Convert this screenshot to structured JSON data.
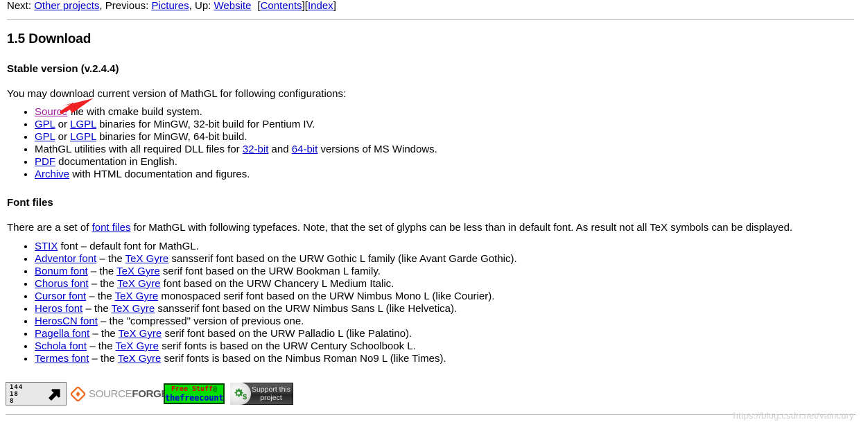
{
  "nav": {
    "next_label": "Next:",
    "next_link": "Other projects",
    "comma1": ",",
    "prev_label": "Previous:",
    "prev_link": "Pictures",
    "comma2": ",",
    "up_label": "Up:",
    "up_link": "Website",
    "bracket_open": "[",
    "contents_link": "Contents",
    "bracket_mid": "][",
    "index_link": "Index",
    "bracket_close": "]"
  },
  "section": {
    "heading": "1.5 Download",
    "subheading": "Stable version (v.2.4.4)",
    "intro": "You may download current version of MathGL for following configurations:"
  },
  "download_items": [
    {
      "parts": [
        {
          "text": "Source",
          "type": "link",
          "state": "visited"
        },
        {
          "text": " file with cmake build system.",
          "type": "text"
        }
      ]
    },
    {
      "parts": [
        {
          "text": "GPL",
          "type": "link"
        },
        {
          "text": " or ",
          "type": "text"
        },
        {
          "text": "LGPL",
          "type": "link"
        },
        {
          "text": " binaries for MinGW, 32-bit build for Pentium IV.",
          "type": "text"
        }
      ]
    },
    {
      "parts": [
        {
          "text": "GPL",
          "type": "link"
        },
        {
          "text": " or ",
          "type": "text"
        },
        {
          "text": "LGPL",
          "type": "link"
        },
        {
          "text": " binaries for MinGW, 64-bit build.",
          "type": "text"
        }
      ]
    },
    {
      "parts": [
        {
          "text": "MathGL utilities with all required DLL files for ",
          "type": "text"
        },
        {
          "text": "32-bit",
          "type": "link"
        },
        {
          "text": " and ",
          "type": "text"
        },
        {
          "text": "64-bit",
          "type": "link"
        },
        {
          "text": " versions of MS Windows.",
          "type": "text"
        }
      ]
    },
    {
      "parts": [
        {
          "text": "PDF",
          "type": "link"
        },
        {
          "text": " documentation in English.",
          "type": "text"
        }
      ]
    },
    {
      "parts": [
        {
          "text": "Archive",
          "type": "link"
        },
        {
          "text": " with HTML documentation and figures.",
          "type": "text"
        }
      ]
    }
  ],
  "fonts_section": {
    "heading": "Font files",
    "intro_parts": [
      {
        "text": "There are a set of ",
        "type": "text"
      },
      {
        "text": "font files",
        "type": "link"
      },
      {
        "text": " for MathGL with following typefaces. Note, that the set of glyphs can be less than in default font. As result not all TeX symbols can be displayed.",
        "type": "text"
      }
    ]
  },
  "font_items": [
    {
      "parts": [
        {
          "text": "STIX",
          "type": "link"
        },
        {
          "text": " font – default font for MathGL.",
          "type": "text"
        }
      ]
    },
    {
      "parts": [
        {
          "text": "Adventor font",
          "type": "link"
        },
        {
          "text": " – the ",
          "type": "text"
        },
        {
          "text": "TeX Gyre",
          "type": "link"
        },
        {
          "text": " sansserif font based on the URW Gothic L family (like Avant Garde Gothic).",
          "type": "text"
        }
      ]
    },
    {
      "parts": [
        {
          "text": "Bonum font",
          "type": "link"
        },
        {
          "text": " – the ",
          "type": "text"
        },
        {
          "text": "TeX Gyre",
          "type": "link"
        },
        {
          "text": " serif font based on the URW Bookman L family.",
          "type": "text"
        }
      ]
    },
    {
      "parts": [
        {
          "text": "Chorus font",
          "type": "link"
        },
        {
          "text": " – the ",
          "type": "text"
        },
        {
          "text": "TeX Gyre",
          "type": "link"
        },
        {
          "text": " font based on the URW Chancery L Medium Italic.",
          "type": "text"
        }
      ]
    },
    {
      "parts": [
        {
          "text": "Cursor font",
          "type": "link"
        },
        {
          "text": " – the ",
          "type": "text"
        },
        {
          "text": "TeX Gyre",
          "type": "link"
        },
        {
          "text": " monospaced serif font based on the URW Nimbus Mono L (like Courier).",
          "type": "text"
        }
      ]
    },
    {
      "parts": [
        {
          "text": "Heros font",
          "type": "link"
        },
        {
          "text": " – the ",
          "type": "text"
        },
        {
          "text": "TeX Gyre",
          "type": "link"
        },
        {
          "text": " sansserif font based on the URW Nimbus Sans L (like Helvetica).",
          "type": "text"
        }
      ]
    },
    {
      "parts": [
        {
          "text": "HerosCN font",
          "type": "link"
        },
        {
          "text": " – the \"compressed\" version of previous one.",
          "type": "text"
        }
      ]
    },
    {
      "parts": [
        {
          "text": "Pagella font",
          "type": "link"
        },
        {
          "text": " – the ",
          "type": "text"
        },
        {
          "text": "TeX Gyre",
          "type": "link"
        },
        {
          "text": " serif font based on the URW Palladio L (like Palatino).",
          "type": "text"
        }
      ]
    },
    {
      "parts": [
        {
          "text": "Schola font",
          "type": "link"
        },
        {
          "text": " – the ",
          "type": "text"
        },
        {
          "text": "TeX Gyre",
          "type": "link"
        },
        {
          "text": " serif fonts is based on the URW Century Schoolbook L.",
          "type": "text"
        }
      ]
    },
    {
      "parts": [
        {
          "text": "Termes font",
          "type": "link"
        },
        {
          "text": " – the ",
          "type": "text"
        },
        {
          "text": "TeX Gyre",
          "type": "link"
        },
        {
          "text": " serif fonts is based on the Nimbus Roman No9 L (like Times).",
          "type": "text"
        }
      ]
    }
  ],
  "footer": {
    "counter": {
      "line1": "144",
      "line2": "18",
      "line3": "8"
    },
    "sourceforge": {
      "text_light": "SOURCE",
      "text_bold": "FORGE"
    },
    "freecountry": {
      "line1_a": "Free Stuff",
      "line1_at": "@",
      "line2": "thefreecountry"
    },
    "support": {
      "line1": "Support this",
      "line2": "project",
      "currency": "$"
    }
  },
  "watermark": "https://blog.csdn.net/vaincury",
  "colors": {
    "link": "#0000cc",
    "visited_link": "#a020a0",
    "arrow_annotation": "#ee2222",
    "rule": "#bdbdbd",
    "sourceforge_orange": "#ef6c23"
  }
}
